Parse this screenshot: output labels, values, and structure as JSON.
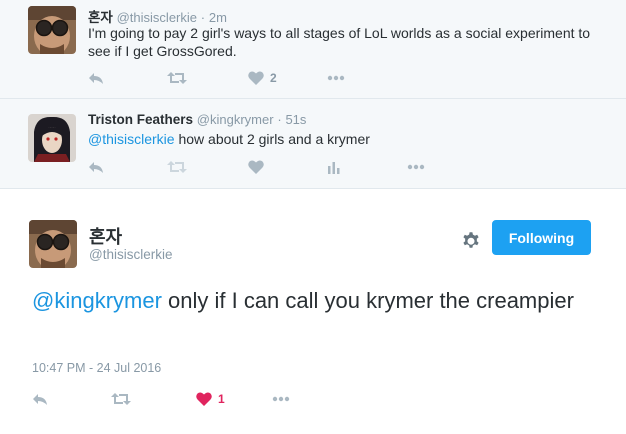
{
  "thread": {
    "tweet1": {
      "name": "혼자",
      "handle": "@thisisclerkie",
      "dot": "·",
      "time": "2m",
      "text": "I'm going to pay 2 girl's ways to all stages of LoL worlds as a social experiment to see if I get GrossGored.",
      "like_count": "2",
      "icons": [
        "reply-icon",
        "retweet-icon",
        "heart-icon",
        "more-icon"
      ]
    },
    "tweet2": {
      "name": "Triston Feathers",
      "handle": "@kingkrymer",
      "dot": "·",
      "time": "51s",
      "mention": "@thisisclerkie",
      "text_rest": " how about 2 girls and a krymer",
      "icons": [
        "reply-icon",
        "retweet-icon",
        "heart-icon",
        "analytics-icon",
        "more-icon"
      ]
    }
  },
  "main": {
    "name": "혼자",
    "handle": "@thisisclerkie",
    "follow_label": "Following",
    "mention": "@kingkrymer",
    "text_rest": " only if I can call you krymer the creampier",
    "timestamp": "10:47 PM - 24 Jul 2016",
    "like_count": "1",
    "icons": [
      "reply-icon",
      "retweet-icon",
      "heart-icon",
      "more-icon",
      "gear-icon"
    ]
  },
  "colors": {
    "accent": "#1da1f2",
    "link": "#1b95e0",
    "muted": "#8899a6",
    "like": "#e0245e",
    "thread_bg": "#f5f8fa"
  }
}
